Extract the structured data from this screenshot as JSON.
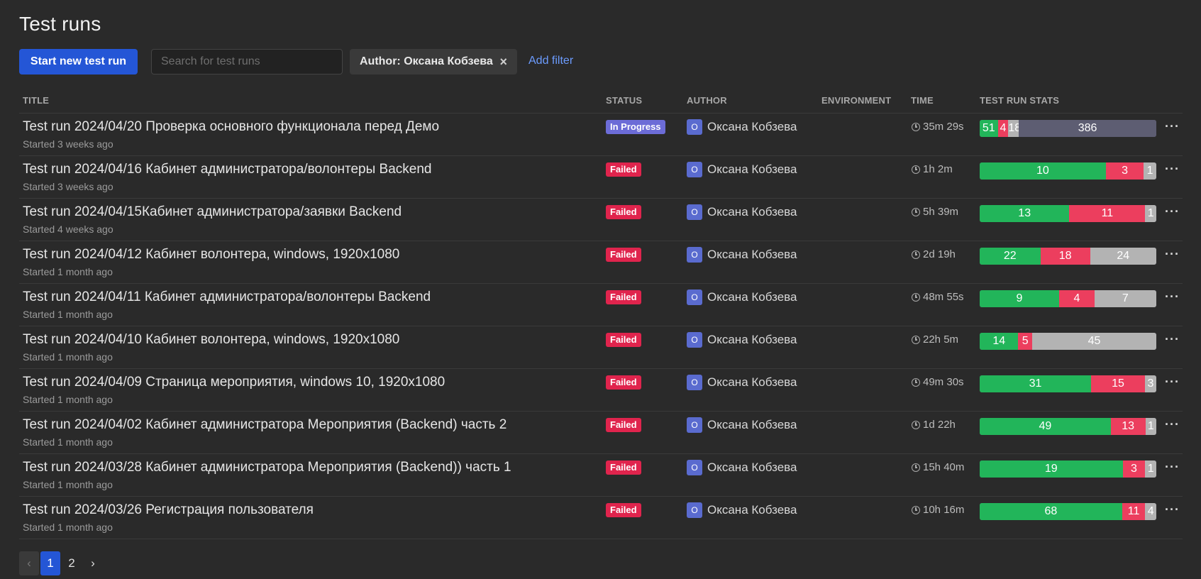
{
  "header": {
    "title": "Test runs"
  },
  "toolbar": {
    "start_button": "Start new test run",
    "search_placeholder": "Search for test runs",
    "filter_chip": "Author: Оксана Кобзева",
    "filter_remove": "×",
    "add_filter": "Add filter"
  },
  "table": {
    "columns": [
      "TITLE",
      "STATUS",
      "AUTHOR",
      "ENVIRONMENT",
      "TIME",
      "TEST RUN STATS"
    ],
    "rows": [
      {
        "title": "Test run 2024/04/20 Проверка основного функционала перед Демо",
        "started": "Started 3 weeks ago",
        "status": "In Progress",
        "status_kind": "progress",
        "avatar": "O",
        "author": "Оксана Кобзева",
        "environment": "",
        "time": "35m 29s",
        "stats": {
          "passed": 51,
          "failed": 4,
          "skipped": 18,
          "untested": 386
        }
      },
      {
        "title": "Test run 2024/04/16 Кабинет администратора/волонтеры Backend",
        "started": "Started 3 weeks ago",
        "status": "Failed",
        "status_kind": "failed",
        "avatar": "O",
        "author": "Оксана Кобзева",
        "environment": "",
        "time": "1h 2m",
        "stats": {
          "passed": 10,
          "failed": 3,
          "skipped": 1
        }
      },
      {
        "title": "Test run 2024/04/15Кабинет администратора/заявки Backend",
        "started": "Started 4 weeks ago",
        "status": "Failed",
        "status_kind": "failed",
        "avatar": "O",
        "author": "Оксана Кобзева",
        "environment": "",
        "time": "5h 39m",
        "stats": {
          "passed": 13,
          "failed": 11,
          "skipped": 1
        }
      },
      {
        "title": "Test run 2024/04/12 Кабинет волонтера, windows, 1920x1080",
        "started": "Started 1 month ago",
        "status": "Failed",
        "status_kind": "failed",
        "avatar": "O",
        "author": "Оксана Кобзева",
        "environment": "",
        "time": "2d 19h",
        "stats": {
          "passed": 22,
          "failed": 18,
          "skipped": 24
        }
      },
      {
        "title": "Test run 2024/04/11 Кабинет администратора/волонтеры Backend",
        "started": "Started 1 month ago",
        "status": "Failed",
        "status_kind": "failed",
        "avatar": "O",
        "author": "Оксана Кобзева",
        "environment": "",
        "time": "48m 55s",
        "stats": {
          "passed": 9,
          "failed": 4,
          "skipped": 7
        }
      },
      {
        "title": "Test run 2024/04/10 Кабинет волонтера, windows, 1920x1080",
        "started": "Started 1 month ago",
        "status": "Failed",
        "status_kind": "failed",
        "avatar": "O",
        "author": "Оксана Кобзева",
        "environment": "",
        "time": "22h 5m",
        "stats": {
          "passed": 14,
          "failed": 5,
          "skipped": 45
        }
      },
      {
        "title": "Test run 2024/04/09 Страница мероприятия, windows 10, 1920x1080",
        "started": "Started 1 month ago",
        "status": "Failed",
        "status_kind": "failed",
        "avatar": "O",
        "author": "Оксана Кобзева",
        "environment": "",
        "time": "49m 30s",
        "stats": {
          "passed": 31,
          "failed": 15,
          "skipped": 3
        }
      },
      {
        "title": "Test run 2024/04/02 Кабинет администратора Мероприятия (Backend) часть 2",
        "started": "Started 1 month ago",
        "status": "Failed",
        "status_kind": "failed",
        "avatar": "O",
        "author": "Оксана Кобзева",
        "environment": "",
        "time": "1d 22h",
        "stats": {
          "passed": 49,
          "failed": 13,
          "skipped": 1
        }
      },
      {
        "title": "Test run 2024/03/28 Кабинет администратора Мероприятия (Backend)) часть 1",
        "started": "Started 1 month ago",
        "status": "Failed",
        "status_kind": "failed",
        "avatar": "O",
        "author": "Оксана Кобзева",
        "environment": "",
        "time": "15h 40m",
        "stats": {
          "passed": 19,
          "failed": 3,
          "skipped": 1
        }
      },
      {
        "title": "Test run 2024/03/26 Регистрация пользователя",
        "started": "Started 1 month ago",
        "status": "Failed",
        "status_kind": "failed",
        "avatar": "O",
        "author": "Оксана Кобзева",
        "environment": "",
        "time": "10h 16m",
        "stats": {
          "passed": 68,
          "failed": 11,
          "skipped": 4
        }
      }
    ]
  },
  "colors": {
    "passed": "#22b55a",
    "failed": "#ec3e5e",
    "skipped": "#b3b3b3",
    "untested": "#5d5d72",
    "accent": "#2456d6"
  },
  "pagination": {
    "prev": "‹",
    "pages": [
      "1",
      "2"
    ],
    "current": "1",
    "next": "›"
  }
}
